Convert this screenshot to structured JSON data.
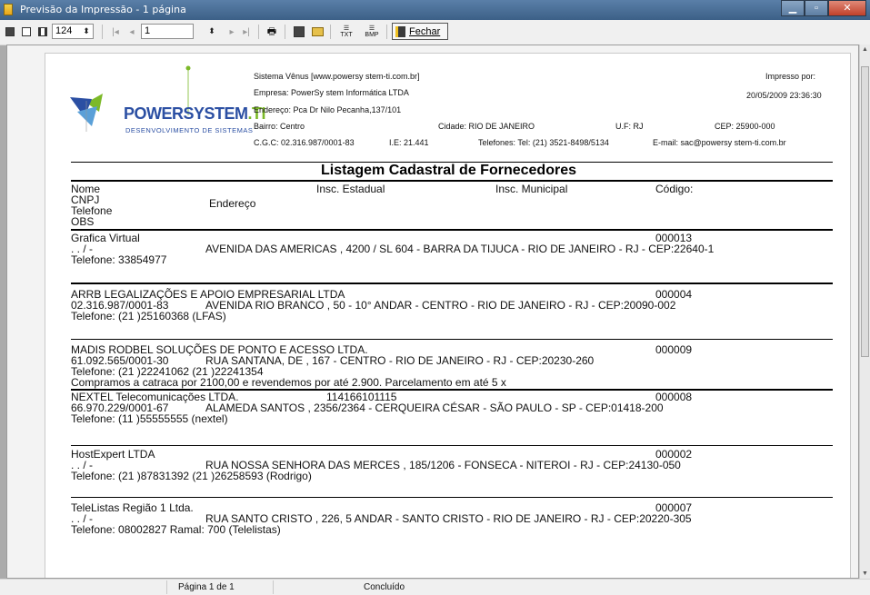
{
  "window": {
    "title": "Previsão da Impressão - 1 página",
    "controls": {
      "minimize": "▁",
      "maximize": "▫",
      "close": "✕"
    }
  },
  "toolbar": {
    "zoom_value": "124",
    "page_value": "1",
    "close_label": "Fechar",
    "txt_label": "TXT",
    "bmp_label": "BMP"
  },
  "report": {
    "logo": {
      "name_main": "POWERSYSTEM",
      "name_ti": ".TI",
      "tagline": "DESENVOLVIMENTO DE SISTEMAS"
    },
    "header": {
      "system": "Sistema Vênus [www.powersy stem-ti.com.br]",
      "company": "Empresa:  PowerSy stem Informática LTDA",
      "address": "Endereço:  Pca Dr Nilo Pecanha,137/101",
      "district": "Bairro:  Centro",
      "city": "Cidade: RIO DE JANEIRO",
      "uf": "U.F: RJ",
      "cep": "CEP:  25900-000",
      "cgc": "C.G.C: 02.316.987/0001-83",
      "ie": "I.E:  21.441",
      "phones": "Telefones:  Tel: (21) 3521-8498/5134",
      "email": "E-mail: sac@powersy stem-ti.com.br",
      "printed_by": "Impresso por:",
      "printed_at": "20/05/2009 23:36:30"
    },
    "title": "Listagem Cadastral de Fornecedores",
    "columns": {
      "nome": "Nome",
      "insc_estadual": "Insc. Estadual",
      "insc_municipal": "Insc. Municipal",
      "codigo": "Código:",
      "cnpj": "CNPJ",
      "endereco": "Endereço",
      "telefone": "Telefone",
      "obs": "OBS"
    },
    "records": [
      {
        "name": "Grafica Virtual",
        "code": "000013",
        "cnpj": " .  .  /  -",
        "address": "AVENIDA DAS AMERICAS , 4200 / SL 604 - BARRA DA TIJUCA - RIO DE JANEIRO - RJ - CEP:22640-1",
        "phone": "Telefone: 33854977"
      },
      {
        "name": "ARRB LEGALIZAÇÕES E APOIO EMPRESARIAL LTDA",
        "code": "000004",
        "cnpj": "02.316.987/0001-83",
        "address": "AVENIDA RIO BRANCO , 50 - 10° ANDAR - CENTRO - RIO DE JANEIRO - RJ - CEP:20090-002",
        "phone": "Telefone:  (21  )25160368  (LFAS)"
      },
      {
        "name": "MADIS RODBEL SOLUÇÕES DE PONTO E ACESSO LTDA.",
        "code": "000009",
        "cnpj": "61.092.565/0001-30",
        "address": "RUA SANTANA, DE , 167 - CENTRO - RIO DE JANEIRO - RJ - CEP:20230-260",
        "phone": "Telefone:  (21  )22241062  (21  )22241354",
        "obs": "Compramos a catraca por 2100,00 e revendemos por até 2.900. Parcelamento em até 5 x"
      },
      {
        "name": "NEXTEL Telecomunicações LTDA.",
        "insc": "114166101115",
        "code": "000008",
        "cnpj": "66.970.229/0001-67",
        "address": "ALAMEDA SANTOS , 2356/2364 - CERQUEIRA CÉSAR - SÃO PAULO - SP - CEP:01418-200",
        "phone": "Telefone:  (11  )55555555  (nextel)"
      },
      {
        "name": "HostExpert LTDA",
        "code": "000002",
        "cnpj": " .  .  /  -",
        "address": "RUA NOSSA SENHORA DAS MERCES , 185/1206 - FONSECA - NITEROI - RJ - CEP:24130-050",
        "phone": "Telefone:  (21  )87831392  (21  )26258593  (Rodrigo)"
      },
      {
        "name": "TeleListas Região 1 Ltda.",
        "code": "000007",
        "cnpj": " .  .  /  -",
        "address": "RUA SANTO CRISTO , 226, 5 ANDAR - SANTO CRISTO - RIO DE JANEIRO - RJ - CEP:20220-305",
        "phone": "Telefone: 08002827 Ramal: 700   (Telelistas)"
      }
    ]
  },
  "statusbar": {
    "page": "Página 1 de 1",
    "state": "Concluído"
  }
}
